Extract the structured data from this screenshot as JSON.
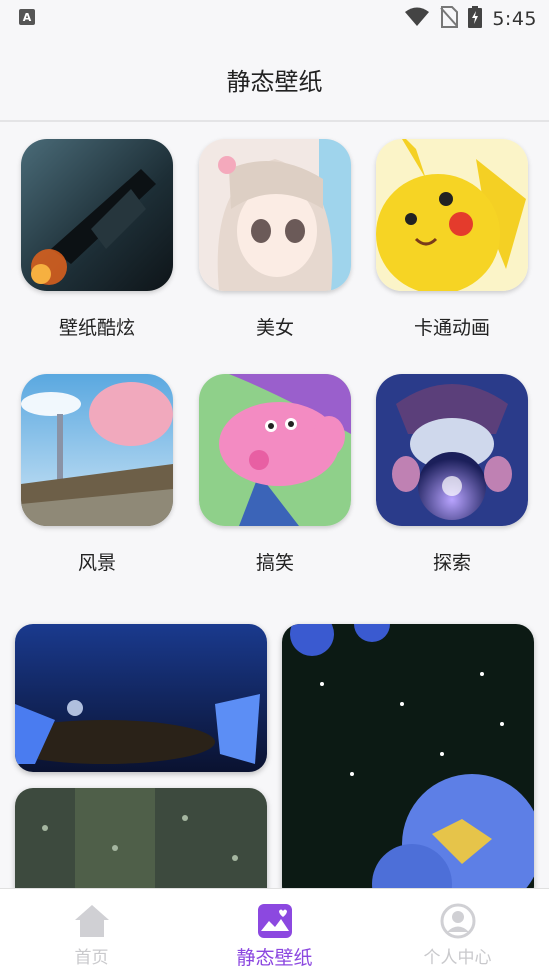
{
  "status_bar": {
    "time": "5:45",
    "icons": [
      "accessibility-icon",
      "wifi-icon",
      "no-sim-icon",
      "battery-charging-icon"
    ]
  },
  "header": {
    "title": "静态壁纸"
  },
  "categories": [
    {
      "label": "壁纸酷炫",
      "icon": "cool-wallpaper-thumbnail"
    },
    {
      "label": "美女",
      "icon": "anime-girl-thumbnail"
    },
    {
      "label": "卡通动画",
      "icon": "pikachu-thumbnail"
    },
    {
      "label": "风景",
      "icon": "scenery-thumbnail"
    },
    {
      "label": "搞笑",
      "icon": "peppa-pig-thumbnail"
    },
    {
      "label": "探索",
      "icon": "wizard-crystal-ball-thumbnail"
    }
  ],
  "feed": [
    {
      "icon": "blue-butterfly-wallpaper"
    },
    {
      "icon": "hydrangea-butterfly-wallpaper"
    },
    {
      "icon": "rain-drops-wallpaper"
    }
  ],
  "bottom_nav": {
    "items": [
      {
        "label": "首页",
        "icon": "home-icon",
        "active": false
      },
      {
        "label": "静态壁纸",
        "icon": "image-heart-icon",
        "active": true
      },
      {
        "label": "个人中心",
        "icon": "user-icon",
        "active": false
      }
    ]
  },
  "colors": {
    "accent": "#8c48e0",
    "inactive": "#c9c9cc",
    "background": "#f7f7f9"
  }
}
